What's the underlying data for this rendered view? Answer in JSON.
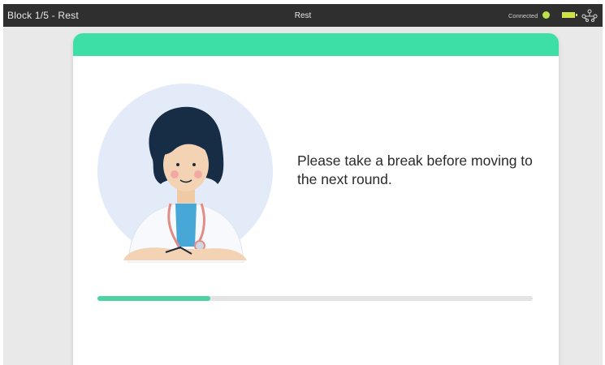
{
  "topbar": {
    "block_label": "Block 1/5 - Rest",
    "title": "Rest",
    "connection_text": "Connected",
    "connection_color": "#bfe04a",
    "battery_color": "#cfe243",
    "icons": [
      "battery-icon",
      "network-icon"
    ]
  },
  "card": {
    "header_color": "#3ddfa7",
    "illustration": "doctor-illustration",
    "message": "Please take a break before moving to the next round.",
    "progress": {
      "fraction": 0.26,
      "color": "#4dd3a1"
    }
  }
}
